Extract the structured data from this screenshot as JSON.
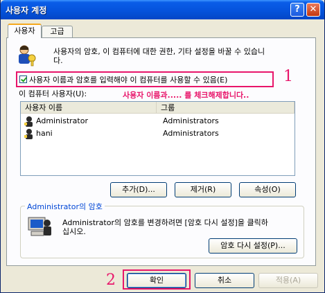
{
  "window": {
    "title": "사용자 계정",
    "help_glyph": "?",
    "close_glyph": "✕"
  },
  "tabs": [
    {
      "label": "사용자",
      "active": true
    },
    {
      "label": "고급",
      "active": false
    }
  ],
  "intro": {
    "line1": "사용자의 암호, 이 컴퓨터에 대한 권한, 기타 설정을 바꿀 수 있습니",
    "line2": "다."
  },
  "checkbox": {
    "label": "사용자 이름과 암호를 입력해야 이 컴퓨터를 사용할 수 있음(E)",
    "checked": true
  },
  "users_label": "이 컴퓨터 사용자(U):",
  "annotation": {
    "text": "사용자 이름과..... 를 체크해제합니다..",
    "mark1": "1",
    "mark2": "2",
    "color": "#e8156a"
  },
  "user_list": {
    "columns": [
      "사용자 이름",
      "그룹"
    ],
    "rows": [
      {
        "name": "Administrator",
        "group": "Administrators"
      },
      {
        "name": "hani",
        "group": "Administrators"
      }
    ]
  },
  "list_buttons": {
    "add": "추가(D)...",
    "remove": "제거(R)",
    "properties": "속성(O)"
  },
  "password_group": {
    "title": "Administrator의 암호",
    "line1": "Administrator의 암호를 변경하려면 [암호 다시 설정]을 클릭하",
    "line2": "십시오.",
    "reset_button": "암호 다시 설정(P)..."
  },
  "footer": {
    "ok": "확인",
    "cancel": "취소",
    "apply": "적용(A)"
  }
}
